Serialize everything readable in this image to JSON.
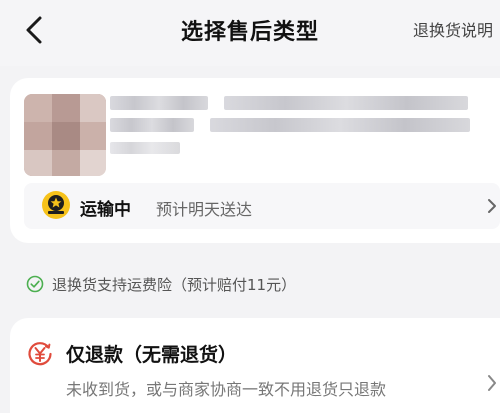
{
  "header": {
    "title": "选择售后类型",
    "link": "退换货说明"
  },
  "product": {
    "delivery": {
      "status": "运输中",
      "eta": "预计明天送达",
      "courier_icon": "courier-logo-icon"
    }
  },
  "notice": {
    "text": "退换货支持运费险（预计赔付11元）",
    "icon": "check-circle-icon"
  },
  "options": [
    {
      "title": "仅退款（无需退货）",
      "description": "未收到货，或与商家协商一致不用退货只退款",
      "icon": "refund-yen-icon"
    }
  ],
  "colors": {
    "background": "#f3f3f5",
    "card": "#ffffff",
    "success": "#4caf50",
    "refund_accent": "#e04b3c",
    "courier_yellow": "#f6c21b"
  }
}
